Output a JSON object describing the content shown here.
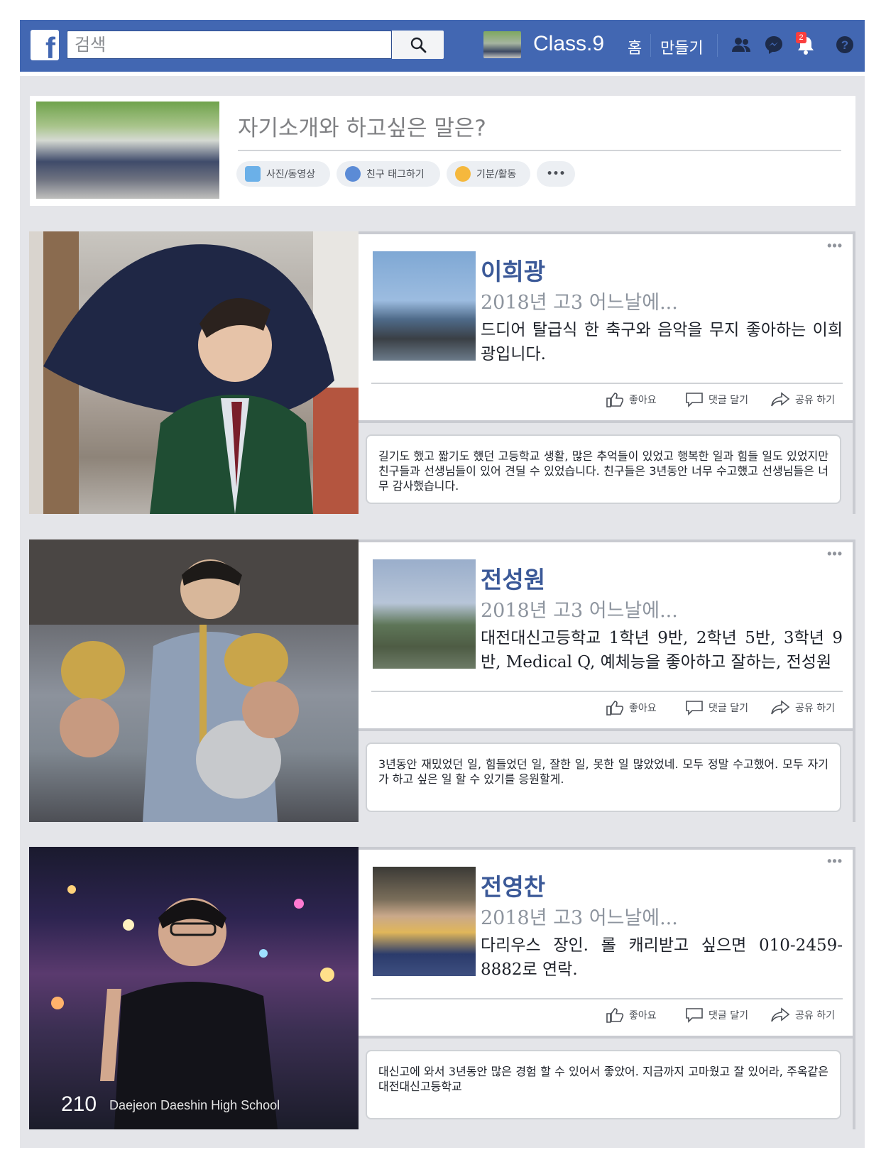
{
  "header": {
    "search_placeholder": "검색",
    "profile_name": "Class.9",
    "nav_home": "홈",
    "nav_create": "만들기",
    "notifications_count": "2",
    "brand_color": "#4267b2"
  },
  "composer": {
    "prompt": "자기소개와 하고싶은 말은?",
    "actions": [
      "사진/동영상",
      "친구 태그하기",
      "기분/활동"
    ],
    "more": "•••"
  },
  "post_actions": {
    "like": "좋아요",
    "comment": "댓글 달기",
    "share": "공유 하기",
    "more": "•••"
  },
  "posts": [
    {
      "name": "이희광",
      "date": "2018년 고3 어느날에...",
      "bio": "드디어 탈급식 한 축구와 음악을 무지 좋아하는 이희광입니다.",
      "message": "길기도 했고 짧기도 했던 고등학교 생활, 많은 추억들이 있었고 행복한 일과 힘들 일도 있었지만 친구들과 선생님들이 있어 견딜 수 있었습니다. 친구들은 3년동안 너무 수고했고 선생님들은 너무 감사했습니다."
    },
    {
      "name": "전성원",
      "date": "2018년 고3 어느날에...",
      "bio": "대전대신고등학교 1학년 9반, 2학년 5반, 3학년 9반, Medical Q, 예체능을 좋아하고 잘하는, 전성원",
      "message": "3년동안 재밌었던 일, 힘들었던 일, 잘한 일, 못한 일 많았었네. 모두 정말 수고했어. 모두 자기가 하고 싶은 일 할 수 있기를 응원할게."
    },
    {
      "name": "전영찬",
      "date": "2018년 고3 어느날에...",
      "bio": "다리우스 장인. 롤 캐리받고 싶으면 010-2459-8882로 연락.",
      "message": "대신고에 와서 3년동안 많은 경험 할 수 있어서 좋았어. 지금까지 고마웠고 잘 있어라, 주옥같은 대전대신고등학교"
    }
  ],
  "footer": {
    "page_number": "210",
    "school": "Daejeon Daeshin High School"
  }
}
